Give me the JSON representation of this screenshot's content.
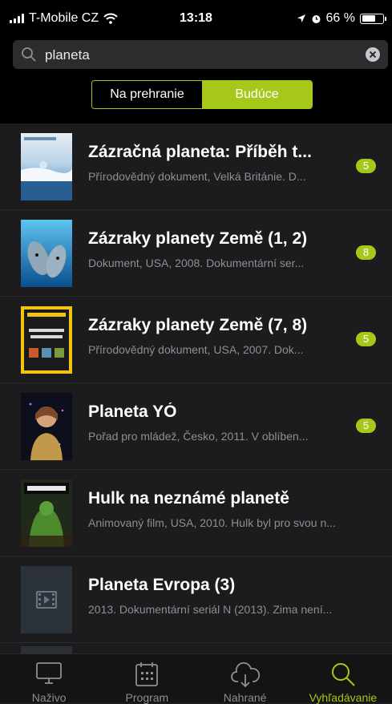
{
  "status_bar": {
    "carrier": "T-Mobile CZ",
    "time": "13:18",
    "battery": "66 %",
    "battery_level": 0.66
  },
  "search": {
    "query": "planeta",
    "placeholder": ""
  },
  "segmented": {
    "past": "Na prehranie",
    "future": "Budúce",
    "selected": "future"
  },
  "results": [
    {
      "title": "Zázračná planeta: Příběh t...",
      "subtitle": "Přírodovědný dokument, Velká Británie. D...",
      "badge": "5",
      "thumb": "ocean-ice"
    },
    {
      "title": "Zázraky planety Země (1, 2)",
      "subtitle": "Dokument, USA, 2008. Dokumentární ser...",
      "badge": "8",
      "thumb": "dolphins"
    },
    {
      "title": "Zázraky planety Země (7, 8)",
      "subtitle": "Přírodovědný dokument, USA, 2007. Dok...",
      "badge": "5",
      "thumb": "natgeo-amazing-planet"
    },
    {
      "title": "Planeta YÓ",
      "subtitle": "Pořad pro mládež, Česko, 2011. V oblíben...",
      "badge": "5",
      "thumb": "girl-portrait"
    },
    {
      "title": "Hulk na neznámé planetě",
      "subtitle": "Animovaný film, USA, 2010. Hulk byl pro svou n...",
      "badge": "",
      "thumb": "hulk-poster"
    },
    {
      "title": "Planeta Evropa (3)",
      "subtitle": "2013. Dokumentární seriál N (2013). Zima není...",
      "badge": "",
      "thumb": "film-placeholder"
    }
  ],
  "tabs": [
    {
      "label": "Naživo",
      "icon": "tv-icon"
    },
    {
      "label": "Program",
      "icon": "calendar-icon"
    },
    {
      "label": "Nahrané",
      "icon": "cloud-download-icon"
    },
    {
      "label": "Vyhľadávanie",
      "icon": "search-icon",
      "active": true
    }
  ],
  "colors": {
    "accent": "#a5c81b",
    "background": "#1c1c1e",
    "bar": "#000000"
  }
}
